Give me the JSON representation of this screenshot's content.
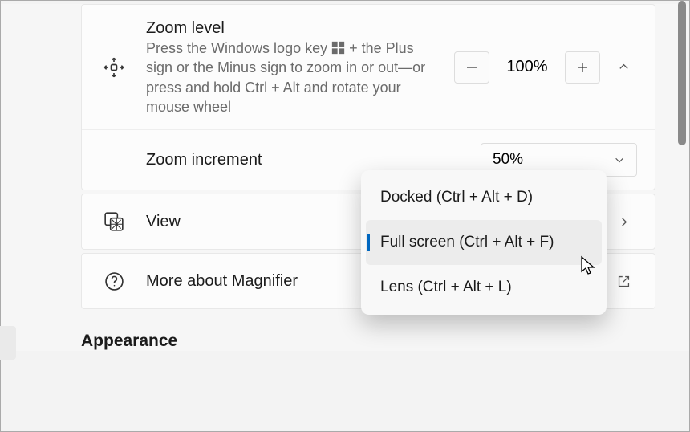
{
  "zoom": {
    "title": "Zoom level",
    "desc_before": "Press the Windows logo key ",
    "desc_after": " + the Plus sign or the Minus sign to zoom in or out—or press and hold Ctrl + Alt and rotate your mouse wheel",
    "value": "100%"
  },
  "increment": {
    "title": "Zoom increment",
    "value": "50%"
  },
  "view": {
    "title": "View",
    "menu": {
      "options": [
        "Docked (Ctrl + Alt + D)",
        "Full screen (Ctrl + Alt + F)",
        "Lens (Ctrl + Alt + L)"
      ],
      "selected_index": 1
    }
  },
  "more": {
    "title": "More about Magnifier"
  },
  "appearance": {
    "title": "Appearance"
  }
}
